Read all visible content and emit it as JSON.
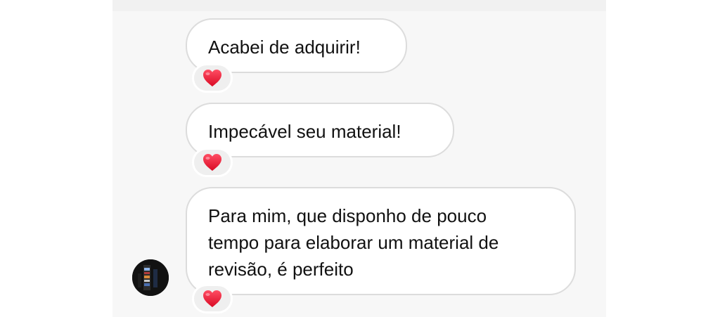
{
  "chat": {
    "messages": [
      {
        "text": "Acabei de adquirir!",
        "reaction": "heart-emoji"
      },
      {
        "text": "Impecável seu material!",
        "reaction": "heart-emoji"
      },
      {
        "text": "Para mim, que disponho de pouco\ntempo para elaborar um material de\nrevisão, é perfeito",
        "reaction": "heart-emoji"
      }
    ],
    "avatar_icon": "profile-photo-avatar"
  },
  "colors": {
    "bubble_border": "#dcdcdc",
    "reaction_background": "#efefef",
    "heart": "#e0102f"
  }
}
